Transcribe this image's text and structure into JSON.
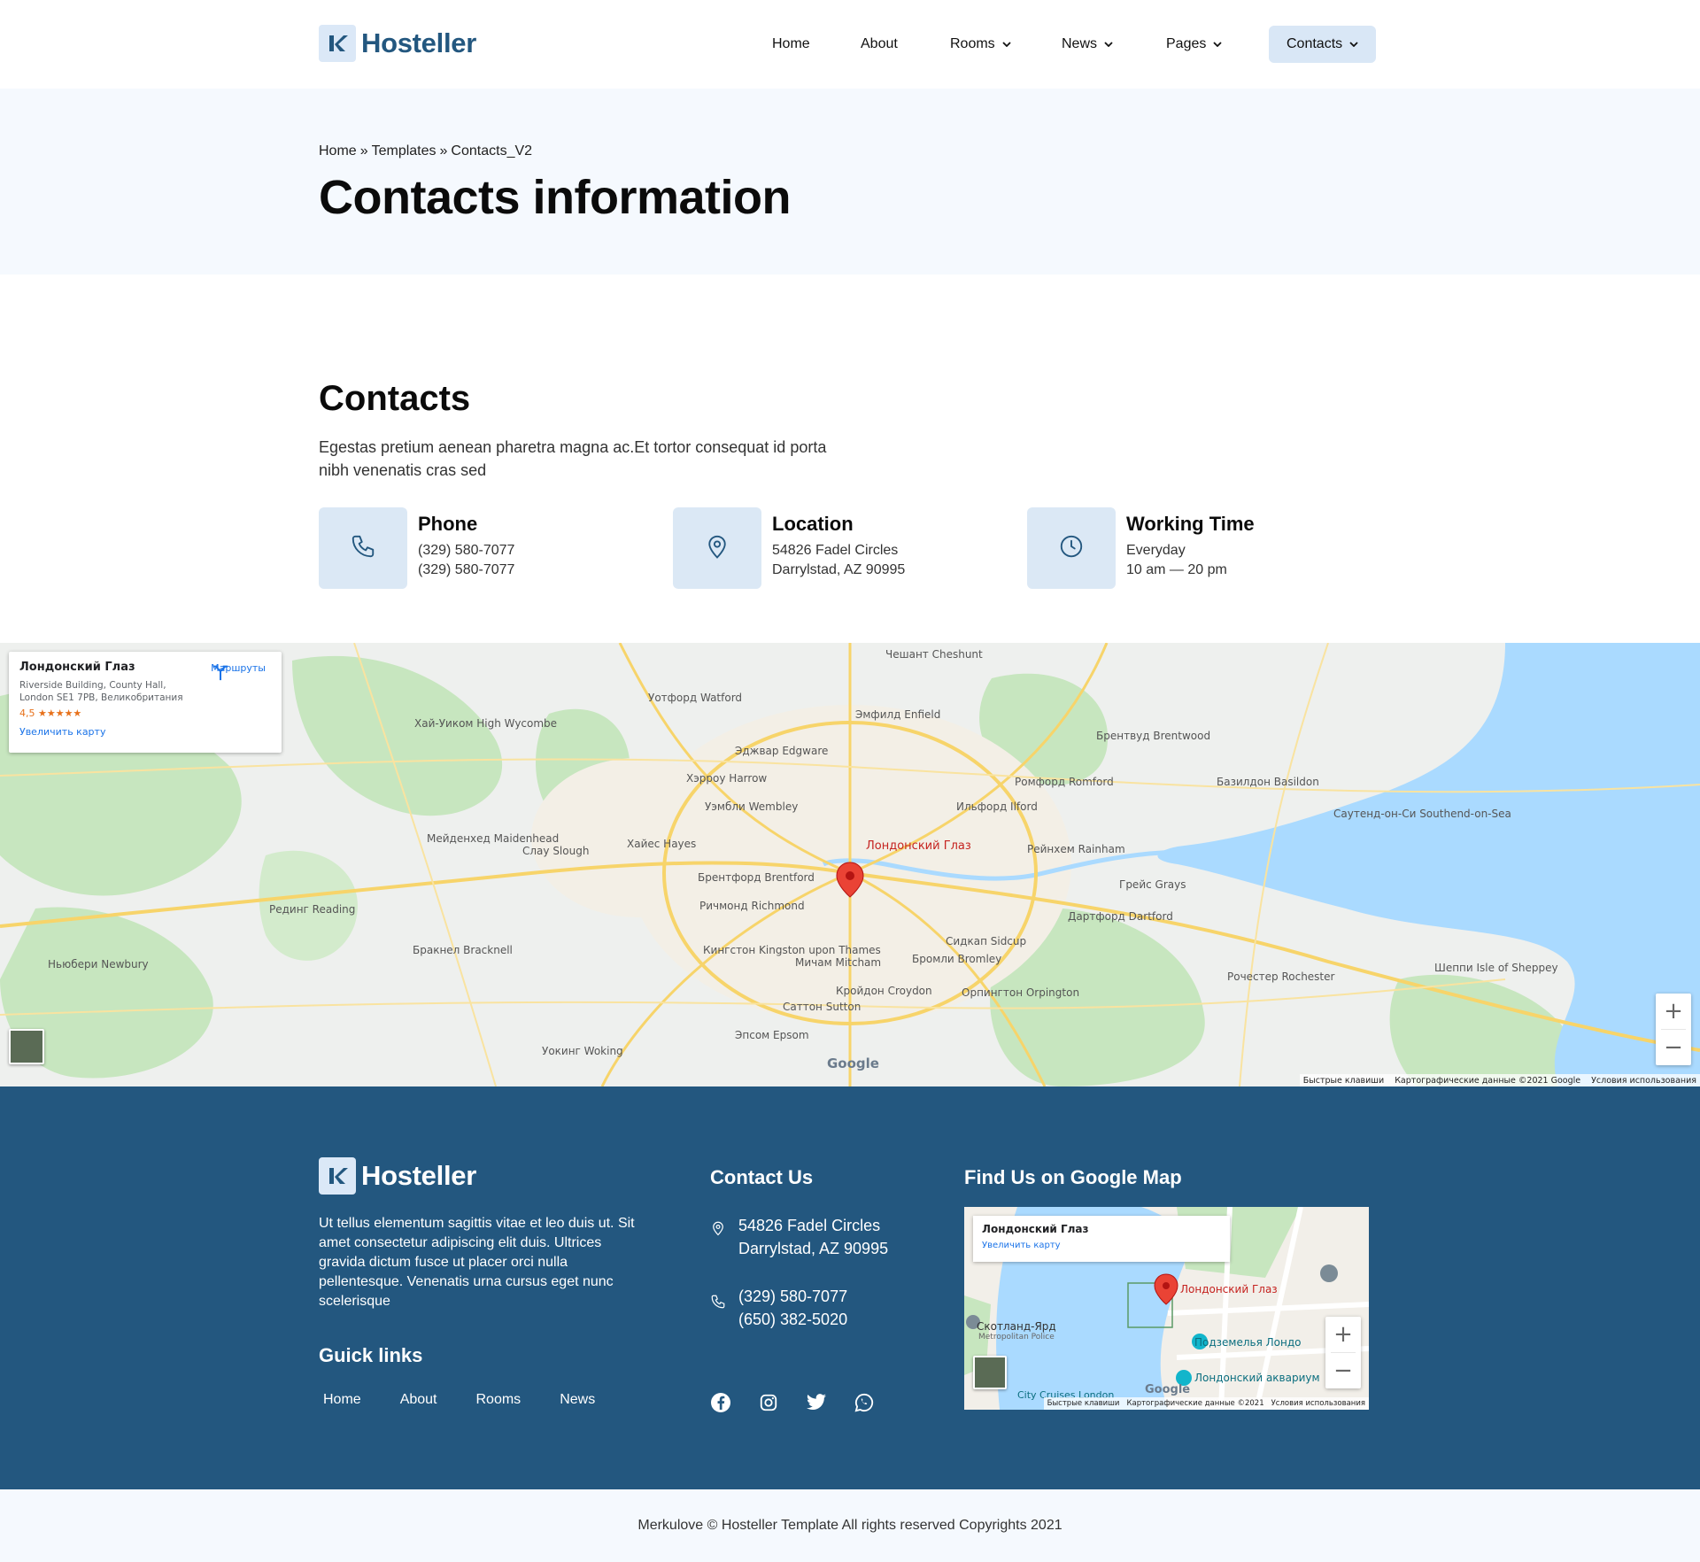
{
  "brand": {
    "name": "Hosteller",
    "accent": "#23577f",
    "light": "#dbe8f5"
  },
  "nav": {
    "items": [
      {
        "label": "Home"
      },
      {
        "label": "About"
      },
      {
        "label": "Rooms"
      },
      {
        "label": "News"
      },
      {
        "label": "Pages"
      },
      {
        "label": "Contacts"
      }
    ]
  },
  "breadcrumb": [
    "Home",
    "Templates",
    "Contacts_V2"
  ],
  "breadcrumb_sep": "»",
  "page_title": "Contacts information",
  "contacts": {
    "title": "Contacts",
    "description": "Egestas pretium aenean pharetra magna ac.Et tortor consequat id porta nibh venenatis cras sed",
    "cards": [
      {
        "icon": "phone-icon",
        "title": "Phone",
        "lines": [
          "(329) 580-7077",
          "(329) 580-7077"
        ]
      },
      {
        "icon": "location-pin-icon",
        "title": "Location",
        "lines": [
          "54826 Fadel Circles",
          "Darrylstad, AZ 90995"
        ]
      },
      {
        "icon": "clock-icon",
        "title": "Working Time",
        "lines": [
          "Everyday",
          "10 am — 20 pm"
        ]
      }
    ]
  },
  "map": {
    "place_name": "Лондонский Глаз",
    "place_address": "Riverside Building, County Hall, London SE1 7PB, Великобритания",
    "rating": "4,5 ★★★★★",
    "enlarge": "Увеличить карту",
    "routes": "Маршруты",
    "marker_label": "Лондонский Глаз",
    "zoom_in": "+",
    "zoom_out": "−",
    "attribution": [
      "Быстрые клавиши",
      "Картографические данные ©2021 Google",
      "Условия использования"
    ],
    "google": "Google",
    "labels": [
      "Уотфорд Watford",
      "Эджвар Edgware",
      "Хай-Уиком High Wycombe",
      "Мейденхед Maidenhead",
      "Слау Slough",
      "Хайес Hayes",
      "Хэрроу Harrow",
      "Уэмбли Wembley",
      "Эмфилд Enfield",
      "Чешант Cheshunt",
      "Ромфорд Romford",
      "Ильфорд Ilford",
      "Брентвуд Brentwood",
      "Базилдон Basildon",
      "Саутенд-он-Си Southend-on-Sea",
      "Грейс Grays",
      "Дартфорд Dartford",
      "Бромли Bromley",
      "Кройдон Croydon",
      "Мичам Mitcham",
      "Саттон Sutton",
      "Эпсом Epsom",
      "Кингстон Kingston upon Thames",
      "Ричмонд Richmond",
      "Брентфорд Brentford",
      "Рединг Reading",
      "Бракнел Bracknell",
      "Ньюбери Newbury",
      "Уокинг Woking",
      "Сидкап Sidcup",
      "Орпингтон Orpington",
      "Рочестер Rochester",
      "Шеппи Isle of Sheppey",
      "Рейнхем Rainham"
    ]
  },
  "footer": {
    "about": "Ut tellus elementum sagittis vitae et leo duis ut. Sit amet consectetur adipiscing elit duis. Ultrices gravida dictum fusce ut placer orci nulla pellentesque. Venenatis urna cursus eget nunc scelerisque",
    "quick_links_title": "Guick links",
    "quick_links": [
      "Home",
      "About",
      "Rooms",
      "News"
    ],
    "contact_title": "Contact Us",
    "address_lines": [
      "54826 Fadel Circles",
      "Darrylstad, AZ 90995"
    ],
    "phone_lines": [
      "(329) 580-7077",
      "(650) 382-5020"
    ],
    "social": [
      "facebook-icon",
      "instagram-icon",
      "twitter-icon",
      "whatsapp-icon"
    ],
    "map_title": "Find Us on Google Map",
    "small_map": {
      "place_name": "Лондонский Глаз",
      "enlarge": "Увеличить карту",
      "marker_label": "Лондонский Глаз",
      "labels": [
        "Скотланд-Ярд",
        "Metropolitan Police",
        "Подземелья Лондо",
        "Лондонский аквариум",
        "City Cruises London"
      ],
      "attribution": [
        "Быстрые клавиши",
        "Картографические данные ©2021",
        "Условия использования"
      ]
    }
  },
  "copyright": "Merkulove © Hosteller Template All rights reserved Copyrights 2021"
}
